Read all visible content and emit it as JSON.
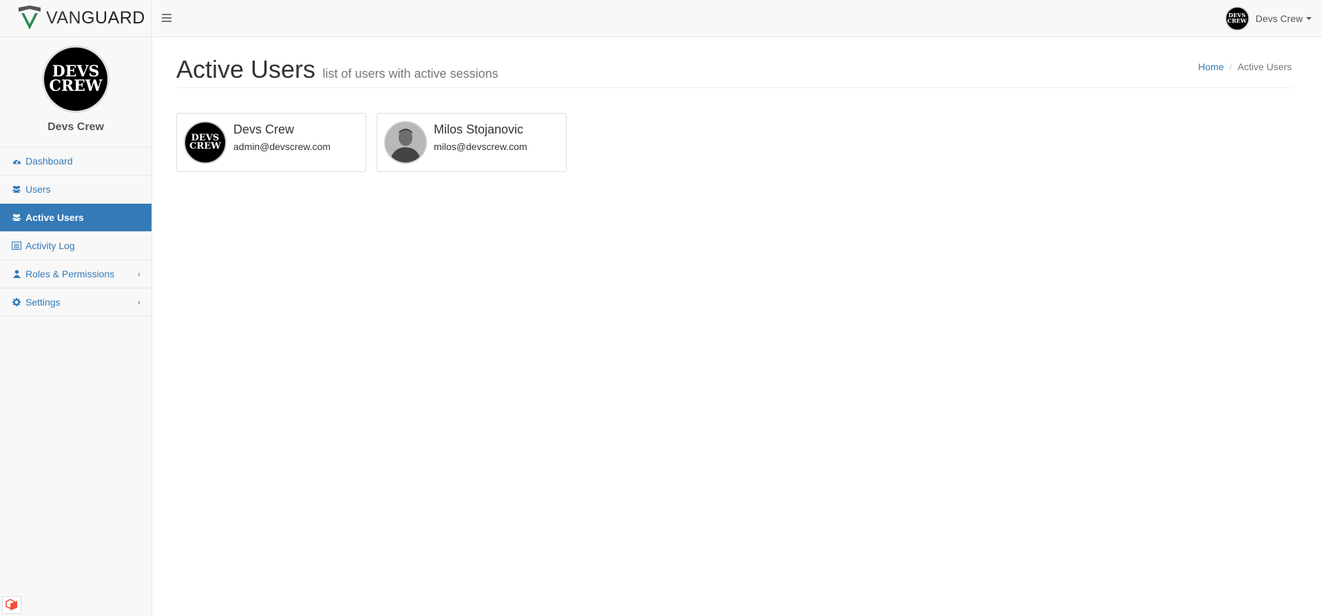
{
  "brand": {
    "name_thin": "VAN",
    "name_bold": "GUARD",
    "accent": "#2e8b57"
  },
  "navbar": {
    "user_name": "Devs Crew"
  },
  "sidebar": {
    "profile_name": "Devs Crew",
    "avatar_text_1": "DEVS",
    "avatar_text_2": "CREW",
    "items": [
      {
        "label": "Dashboard",
        "icon": "dashboard-icon"
      },
      {
        "label": "Users",
        "icon": "users-icon"
      },
      {
        "label": "Active Users",
        "icon": "users-icon",
        "active": true
      },
      {
        "label": "Activity Log",
        "icon": "list-icon"
      },
      {
        "label": "Roles & Permissions",
        "icon": "user-icon",
        "expandable": true
      },
      {
        "label": "Settings",
        "icon": "gear-icon",
        "expandable": true
      }
    ]
  },
  "page": {
    "title": "Active Users",
    "subtitle": "list of users with active sessions",
    "breadcrumb": {
      "home": "Home",
      "current": "Active Users"
    }
  },
  "users": [
    {
      "name": "Devs Crew",
      "email": "admin@devscrew.com"
    },
    {
      "name": "Milos Stojanovic",
      "email": "milos@devscrew.com"
    }
  ],
  "colors": {
    "primary": "#337ab7",
    "sidebar_bg": "#f8f8f8"
  }
}
